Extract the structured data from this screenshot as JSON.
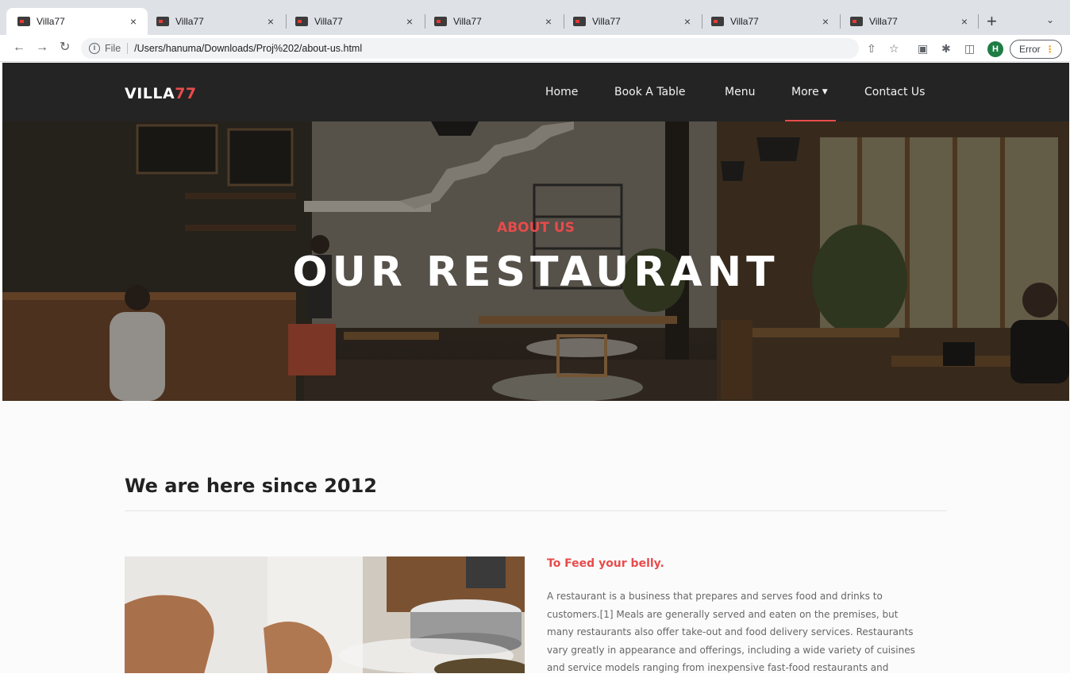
{
  "browser": {
    "tabs": [
      {
        "title": "Villa77",
        "active": true
      },
      {
        "title": "Villa77",
        "active": false
      },
      {
        "title": "Villa77",
        "active": false
      },
      {
        "title": "Villa77",
        "active": false
      },
      {
        "title": "Villa77",
        "active": false
      },
      {
        "title": "Villa77",
        "active": false
      },
      {
        "title": "Villa77",
        "active": false
      }
    ],
    "tab_close_glyph": "×",
    "new_tab_glyph": "+",
    "address": {
      "scheme_label": "File",
      "url": "/Users/hanuma/Downloads/Proj%202/about-us.html"
    },
    "profile_initial": "H",
    "error_label": "Error"
  },
  "site": {
    "logo": {
      "main": "VILLA",
      "accent": "77"
    },
    "nav": [
      {
        "label": "Home"
      },
      {
        "label": "Book A Table"
      },
      {
        "label": "Menu"
      },
      {
        "label": "More",
        "dropdown": true,
        "active": true
      },
      {
        "label": "Contact Us"
      }
    ],
    "hero": {
      "subtitle": "ABOUT US",
      "title": "OUR RESTAURANT"
    },
    "section": {
      "title": "We are here since 2012"
    },
    "feature": {
      "title": "To Feed your belly.",
      "lines": [
        "A restaurant is a business that prepares and serves food and drinks to",
        "customers.[1] Meals are generally served and eaten on the premises, but",
        "many restaurants also offer take-out and food delivery services. Restaurants",
        "vary greatly in appearance and offerings, including a wide variety of cuisines",
        "and service models ranging from inexpensive fast-food restaurants and"
      ]
    }
  },
  "colors": {
    "accent": "#e84b4b",
    "nav_bg": "#242424",
    "content_bg": "#fbfbfb"
  }
}
